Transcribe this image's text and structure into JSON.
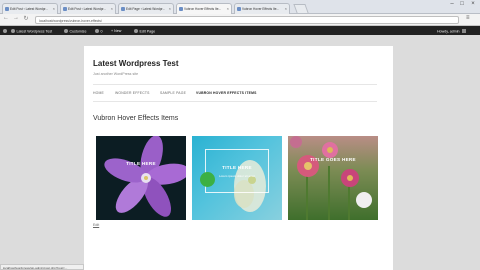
{
  "browser": {
    "tabs": [
      {
        "title": "Edit Post ‹ Latest Wordpr..."
      },
      {
        "title": "Edit Post ‹ Latest Wordpr..."
      },
      {
        "title": "Edit Page ‹ Latest Wordpr..."
      },
      {
        "title": "Vubron Hover Effects Ite..."
      },
      {
        "title": "Vubron Hover Effects Ite..."
      }
    ],
    "address": "localhost/wordpress/vubron-hover-effects/",
    "status_url": "localhost/wordpress/wp-admin/post.php?post=..."
  },
  "adminbar": {
    "site_name": "Latest Wordpress Test",
    "customize": "Customize",
    "comments_count": "0",
    "new_label": "+ New",
    "edit_page": "Edit Page",
    "howdy": "Howdy, admin"
  },
  "site": {
    "title": "Latest Wordpress Test",
    "description": "Just another WordPress site"
  },
  "nav": [
    {
      "label": "Home"
    },
    {
      "label": "Wonder Effects"
    },
    {
      "label": "Sample Page"
    },
    {
      "label": "Vubron Hover Effects Items"
    }
  ],
  "page": {
    "title": "Vubron Hover Effects Items",
    "tiles": [
      {
        "title": "TITLE HERE",
        "image": "purple-flower"
      },
      {
        "title": "TITLE HERE",
        "subtitle": "Lorem ipsum dolor sit amet",
        "image": "white-flower-on-teal"
      },
      {
        "title": "TITLE GOES HERE",
        "image": "pink-daisies"
      }
    ],
    "edit_link": "Edit"
  },
  "colors": {
    "admin_bar": "#222222",
    "tile_highlight": "#3cb044"
  }
}
